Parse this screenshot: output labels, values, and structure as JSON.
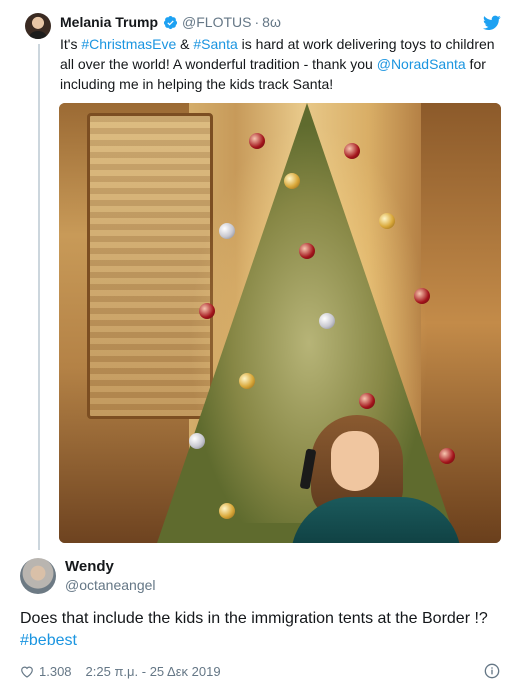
{
  "parent": {
    "name": "Melania Trump",
    "handle": "@FLOTUS",
    "separator": "·",
    "time": "8ω",
    "text_parts": [
      {
        "t": "It's ",
        "link": false
      },
      {
        "t": "#ChristmasEve",
        "link": true
      },
      {
        "t": " & ",
        "link": false
      },
      {
        "t": "#Santa",
        "link": true
      },
      {
        "t": " is hard at work delivering toys to children all over the world! A wonderful tradition - thank you ",
        "link": false
      },
      {
        "t": "@NoradSanta",
        "link": true
      },
      {
        "t": " for including me in helping the kids track Santa!",
        "link": false
      }
    ]
  },
  "reply": {
    "name": "Wendy",
    "handle": "@octaneangel",
    "text": "Does that include the kids in the immigration tents at the Border !?",
    "hashtag": "#bebest",
    "likes": "1.308",
    "timestamp": "2:25 π.μ. - 25 Δεκ 2019"
  },
  "icons": {
    "verified": "verified-badge-icon",
    "bird": "twitter-bird-icon",
    "heart": "heart-icon",
    "info": "info-icon"
  },
  "colors": {
    "link": "#1b95e0",
    "secondary_text": "#657786",
    "thread_line": "#ccd6dd"
  }
}
